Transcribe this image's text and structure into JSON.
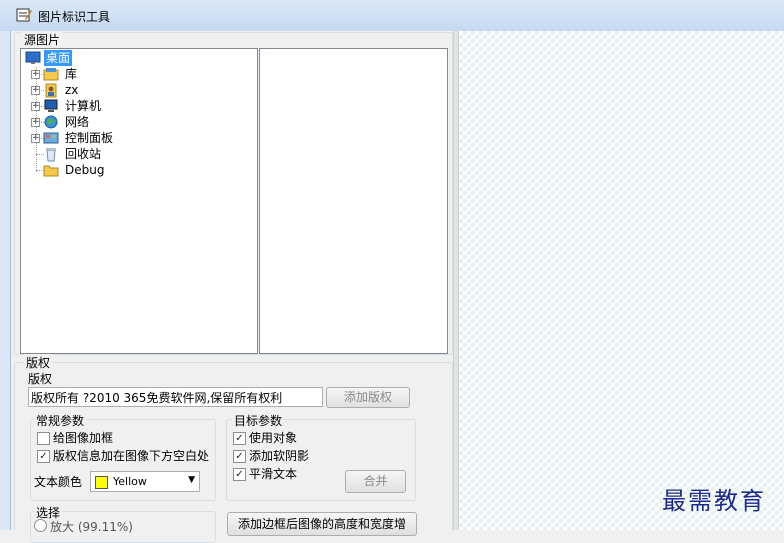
{
  "window": {
    "title": "图片标识工具",
    "icon": "image-tool-icon"
  },
  "source_panel": {
    "legend": "源图片",
    "tree": [
      {
        "label": "桌面",
        "icon": "desktop-icon",
        "selected": true,
        "expandable": false
      },
      {
        "label": "库",
        "icon": "library-icon",
        "selected": false,
        "expandable": true
      },
      {
        "label": "zx",
        "icon": "user-folder-icon",
        "selected": false,
        "expandable": true
      },
      {
        "label": "计算机",
        "icon": "computer-icon",
        "selected": false,
        "expandable": true
      },
      {
        "label": "网络",
        "icon": "network-icon",
        "selected": false,
        "expandable": true
      },
      {
        "label": "控制面板",
        "icon": "control-panel-icon",
        "selected": false,
        "expandable": true
      },
      {
        "label": "回收站",
        "icon": "recycle-bin-icon",
        "selected": false,
        "expandable": false
      },
      {
        "label": "Debug",
        "icon": "folder-icon",
        "selected": false,
        "expandable": false
      }
    ]
  },
  "copyright": {
    "legend": "版权",
    "label": "版权",
    "text_value": "版权所有 ?2010 365免费软件网,保留所有权利",
    "add_button": "添加版权",
    "general": {
      "legend": "常规参数",
      "add_frame": {
        "label": "给图像加框",
        "checked": false
      },
      "place_below": {
        "label": "版权信息加在图像下方空白处",
        "checked": true
      },
      "text_color_label": "文本颜色",
      "text_color_value": "Yellow",
      "text_color_hex": "#ffff00"
    },
    "target": {
      "legend": "目标参数",
      "use_object": {
        "label": "使用对象",
        "checked": true
      },
      "add_shadow": {
        "label": "添加软阴影",
        "checked": true
      },
      "smooth_text": {
        "label": "平滑文本",
        "checked": true
      },
      "merge_button": "合并"
    },
    "select": {
      "legend": "选择",
      "option_label": "放大 (99.11%)"
    },
    "border_button": "添加边框后图像的高度和宽度增"
  },
  "watermark": "最需教育"
}
